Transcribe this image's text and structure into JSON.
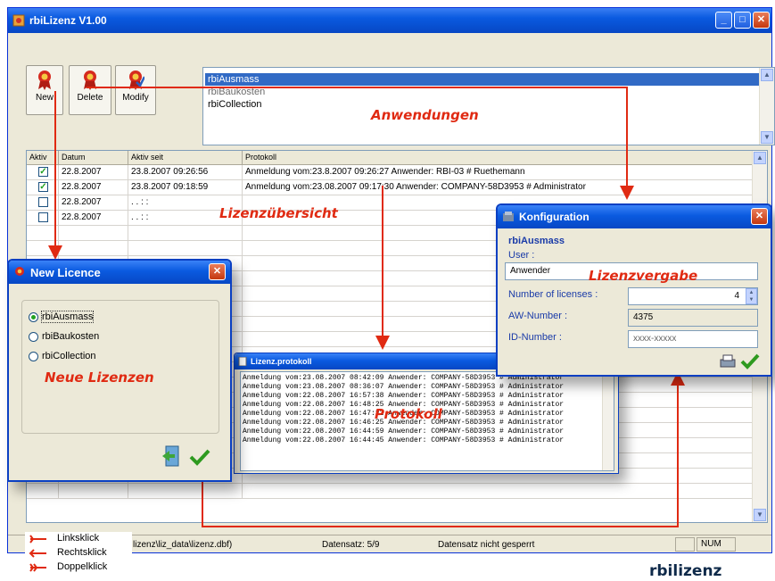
{
  "window": {
    "title": "rbiLizenz V1.00"
  },
  "toolbar": {
    "new": "New",
    "delete": "Delete",
    "modify": "Modify"
  },
  "apps": [
    "rbiAusmass",
    "rbiBaukosten",
    "rbiCollection"
  ],
  "grid": {
    "headers": [
      "Aktiv",
      "Datum",
      "Aktiv seit",
      "Protokoll"
    ],
    "rows": [
      {
        "aktiv": true,
        "datum": "22.8.2007",
        "seit": "23.8.2007 09:26:56",
        "protokoll": "Anmeldung vom:23.8.2007 09:26:27 Anwender: RBI-03 # Ruethemann"
      },
      {
        "aktiv": true,
        "datum": "22.8.2007",
        "seit": "23.8.2007 09:18:59",
        "protokoll": "Anmeldung vom:23.08.2007 09:17:30 Anwender: COMPANY-58D3953 # Administrator"
      },
      {
        "aktiv": false,
        "datum": "22.8.2007",
        "seit": ".  .     : :",
        "protokoll": ""
      },
      {
        "aktiv": false,
        "datum": "22.8.2007",
        "seit": ".  .     : :",
        "protokoll": ""
      }
    ]
  },
  "status": {
    "path": "lizenz\\liz_data\\lizenz.dbf)",
    "record": "Datensatz: 5/9",
    "lock": "Datensatz nicht gesperrt",
    "num": "NUM"
  },
  "new_licence": {
    "title": "New Licence",
    "options": [
      "rbiAusmass",
      "rbiBaukosten",
      "rbiCollection"
    ],
    "selected": 0
  },
  "konfiguration": {
    "title": "Konfiguration",
    "app": "rbiAusmass",
    "user_label": "User :",
    "user_value": "Anwender",
    "licenses_label": "Number of licenses :",
    "licenses_value": "4",
    "aw_label": "AW-Number :",
    "aw_value": "4375",
    "id_label": "ID-Number :",
    "id_value": "xxxx-xxxxx"
  },
  "protokoll_window": {
    "title": "Lizenz.protokoll",
    "lines": [
      "Anmeldung vom:23.08.2007 08:42:09 Anwender: COMPANY-58D3953 # Administrator",
      "Anmeldung vom:23.08.2007 08:36:07 Anwender: COMPANY-58D3953 # Administrator",
      "Anmeldung vom:22.08.2007 16:57:38 Anwender: COMPANY-58D3953 # Administrator",
      "Anmeldung vom:22.08.2007 16:48:25 Anwender: COMPANY-58D3953 # Administrator",
      "Anmeldung vom:22.08.2007 16:47:32 Anwender: COMPANY-58D3953 # Administrator",
      "Anmeldung vom:22.08.2007 16:46:25 Anwender: COMPANY-58D3953 # Administrator",
      "Anmeldung vom:22.08.2007 16:44:59 Anwender: COMPANY-58D3953 # Administrator",
      "Anmeldung vom:22.08.2007 16:44:45 Anwender: COMPANY-58D3953 # Administrator"
    ]
  },
  "annotations": {
    "anwendungen": "Anwendungen",
    "lizenzuebersicht": "Lizenzübersicht",
    "lizenzvergabe": "Lizenzvergabe",
    "neue": "Neue Lizenzen",
    "protokoll": "Protokoll"
  },
  "legend": {
    "links": "Linksklick",
    "rechts": "Rechtsklick",
    "doppel": "Doppelklick"
  },
  "brand": "rbilizenz",
  "colors": {
    "annotation": "#e02a12",
    "titlebar": "#0a5ae0",
    "selection": "#316ac5",
    "check": "#21a121"
  }
}
